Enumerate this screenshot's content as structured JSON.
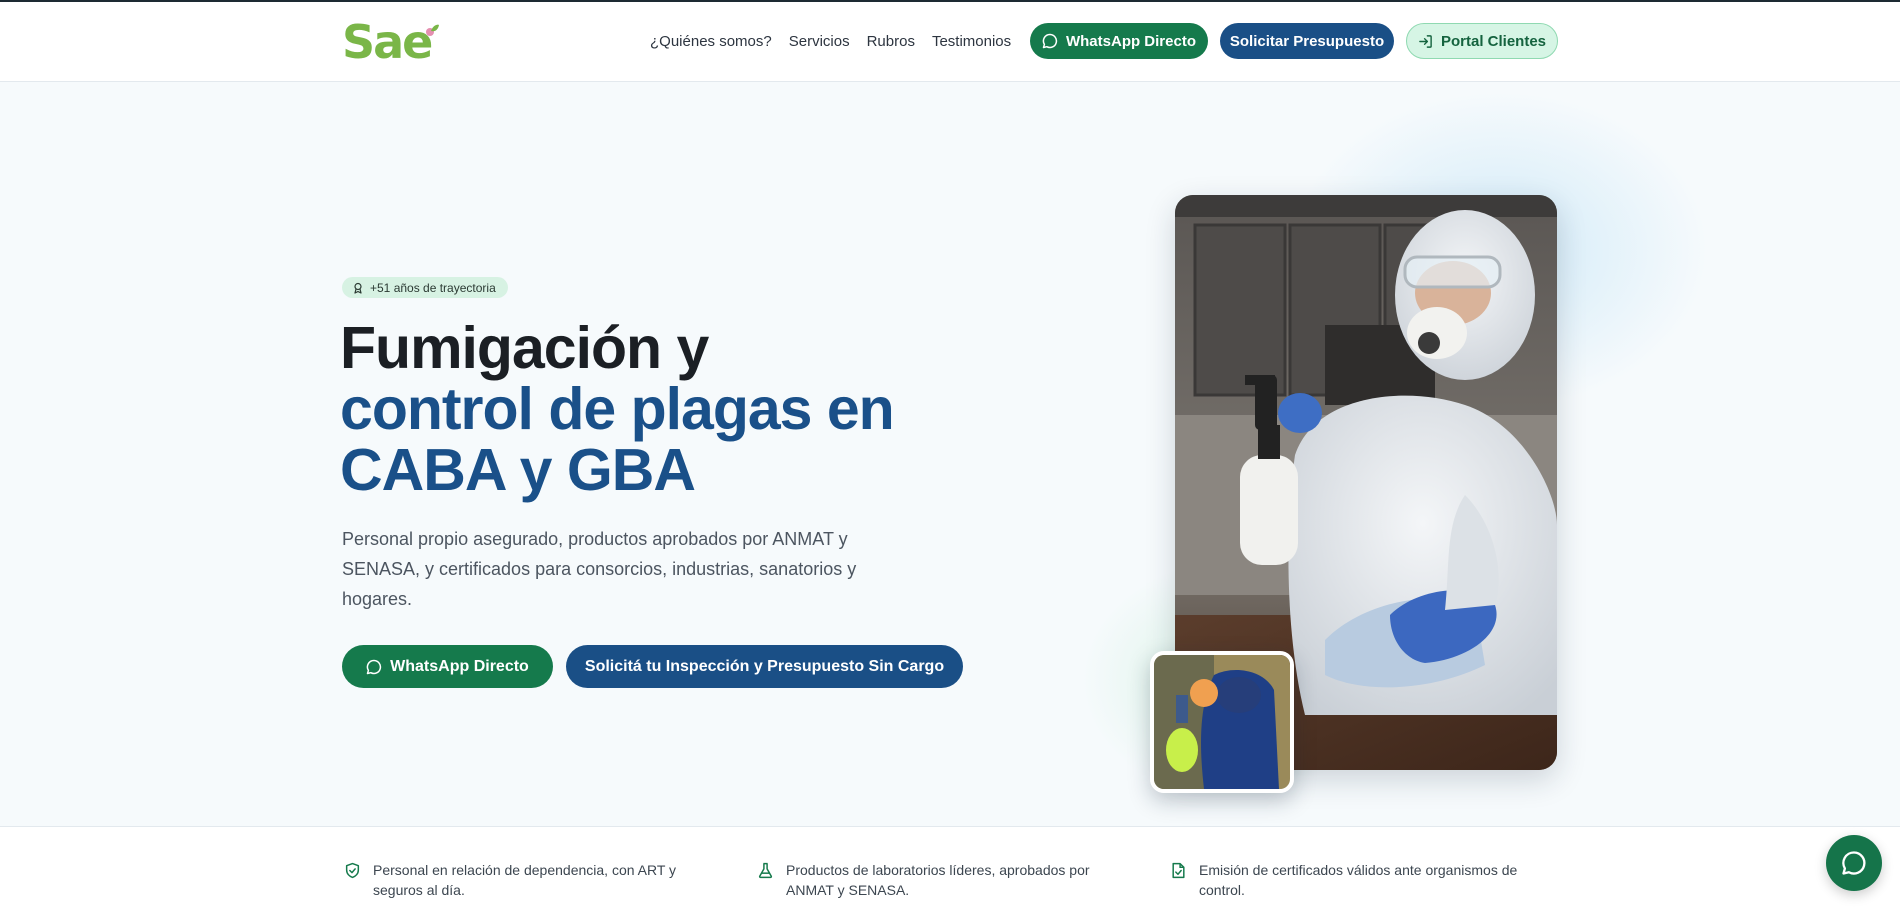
{
  "header": {
    "logo_text": "Sae",
    "nav_links": [
      "¿Quiénes somos?",
      "Servicios",
      "Rubros",
      "Testimonios"
    ],
    "whatsapp_label": "WhatsApp Directo",
    "quote_label": "Solicitar Presupuesto",
    "portal_label": "Portal Clientes"
  },
  "hero": {
    "badge": "+51 años de trayectoria",
    "title_line1": "Fumigación y",
    "title_line2": "control de plagas en",
    "title_line3": "CABA y GBA",
    "description": "Personal propio asegurado, productos aprobados por ANMAT y SENASA, y certificados para consorcios, industrias, sanatorios y hogares.",
    "whatsapp_label": "WhatsApp Directo",
    "inspection_label": "Solicitá tu Inspección y Presupuesto Sin Cargo"
  },
  "features": [
    {
      "icon": "shield-check-icon",
      "text": "Personal en relación de dependencia, con ART y seguros al día."
    },
    {
      "icon": "flask-icon",
      "text": "Productos de laboratorios líderes, aprobados por ANMAT y SENASA."
    },
    {
      "icon": "file-check-icon",
      "text": "Emisión de certificados válidos ante organismos de control."
    }
  ],
  "colors": {
    "brand_green": "#157a4c",
    "brand_blue": "#1a4f86",
    "logo_green": "#7ab648",
    "badge_bg": "#d7f2e3"
  }
}
